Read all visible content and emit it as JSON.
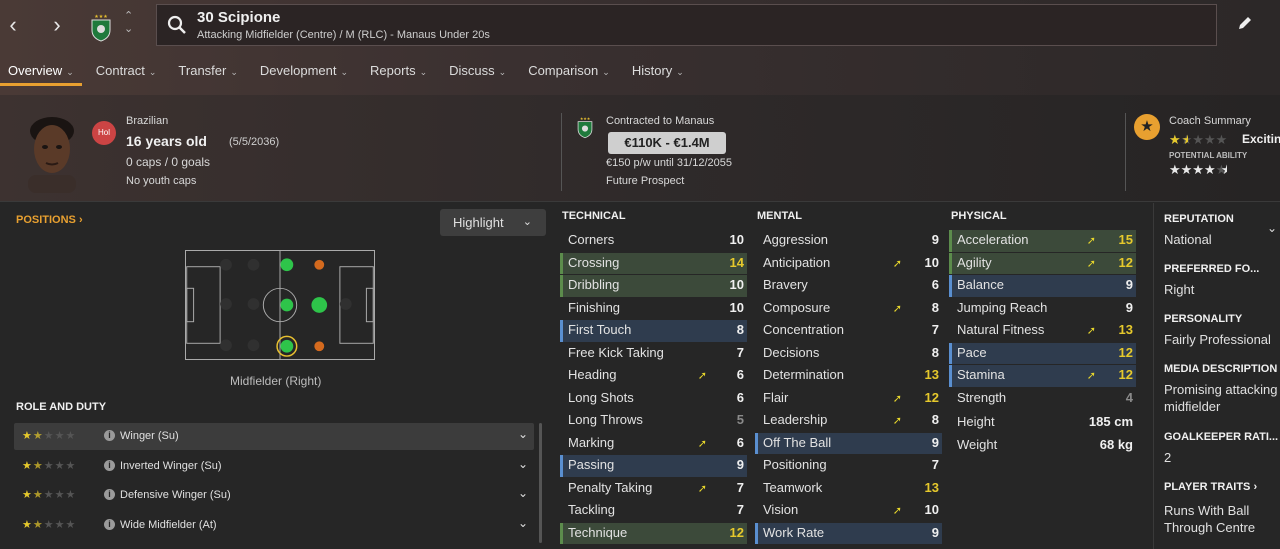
{
  "header": {
    "player_title": "30 Scipione",
    "player_subtitle": "Attacking Midfielder (Centre) / M (RLC) - Manaus Under 20s",
    "tabs": [
      {
        "label": "Overview",
        "active": true
      },
      {
        "label": "Contract"
      },
      {
        "label": "Transfer"
      },
      {
        "label": "Development"
      },
      {
        "label": "Reports"
      },
      {
        "label": "Discuss"
      },
      {
        "label": "Comparison"
      },
      {
        "label": "History"
      }
    ]
  },
  "profile": {
    "nationality": "Brazilian",
    "hol_badge": "Hol",
    "age": "16 years old",
    "dob": "(5/5/2036)",
    "caps": "0 caps / 0 goals",
    "youth_caps": "No youth caps"
  },
  "contract": {
    "contracted_to": "Contracted to Manaus",
    "value_range": "€110K - €1.4M",
    "wage": "€150 p/w until 31/12/2055",
    "status": "Future Prospect"
  },
  "coach": {
    "title": "Coach Summary",
    "current_stars": 1.5,
    "label": "Excitin",
    "potential_label": "POTENTIAL ABILITY",
    "potential_stars": 4.5
  },
  "positions": {
    "title": "POSITIONS",
    "highlight_label": "Highlight",
    "position_label": "Midfielder (Right)"
  },
  "role_duty": {
    "title": "ROLE AND DUTY",
    "roles": [
      {
        "name": "Winger (Su)",
        "stars": 1.5,
        "selected": true
      },
      {
        "name": "Inverted Winger (Su)",
        "stars": 1.5
      },
      {
        "name": "Defensive Winger (Su)",
        "stars": 1.5
      },
      {
        "name": "Wide Midfielder (At)",
        "stars": 1.5
      }
    ]
  },
  "technical": {
    "title": "TECHNICAL",
    "attrs": [
      {
        "name": "Corners",
        "value": "10"
      },
      {
        "name": "Crossing",
        "value": "14",
        "hl": "g",
        "hi": true
      },
      {
        "name": "Dribbling",
        "value": "10",
        "hl": "g"
      },
      {
        "name": "Finishing",
        "value": "10"
      },
      {
        "name": "First Touch",
        "value": "8",
        "hl": "b"
      },
      {
        "name": "Free Kick Taking",
        "value": "7"
      },
      {
        "name": "Heading",
        "value": "6",
        "arrow": true
      },
      {
        "name": "Long Shots",
        "value": "6"
      },
      {
        "name": "Long Throws",
        "value": "5",
        "lo": true
      },
      {
        "name": "Marking",
        "value": "6",
        "arrow": true
      },
      {
        "name": "Passing",
        "value": "9",
        "hl": "b"
      },
      {
        "name": "Penalty Taking",
        "value": "7",
        "arrow": true
      },
      {
        "name": "Tackling",
        "value": "7"
      },
      {
        "name": "Technique",
        "value": "12",
        "hl": "g",
        "hi": true
      }
    ]
  },
  "mental": {
    "title": "MENTAL",
    "attrs": [
      {
        "name": "Aggression",
        "value": "9"
      },
      {
        "name": "Anticipation",
        "value": "10",
        "arrow": true
      },
      {
        "name": "Bravery",
        "value": "6"
      },
      {
        "name": "Composure",
        "value": "8",
        "arrow": true
      },
      {
        "name": "Concentration",
        "value": "7"
      },
      {
        "name": "Decisions",
        "value": "8"
      },
      {
        "name": "Determination",
        "value": "13",
        "hi": true
      },
      {
        "name": "Flair",
        "value": "12",
        "arrow": true,
        "hi": true
      },
      {
        "name": "Leadership",
        "value": "8",
        "arrow": true
      },
      {
        "name": "Off The Ball",
        "value": "9",
        "hl": "b"
      },
      {
        "name": "Positioning",
        "value": "7"
      },
      {
        "name": "Teamwork",
        "value": "13",
        "hi": true
      },
      {
        "name": "Vision",
        "value": "10",
        "arrow": true
      },
      {
        "name": "Work Rate",
        "value": "9",
        "hl": "b"
      }
    ]
  },
  "physical": {
    "title": "PHYSICAL",
    "attrs": [
      {
        "name": "Acceleration",
        "value": "15",
        "hl": "g",
        "arrow": true,
        "hi": true
      },
      {
        "name": "Agility",
        "value": "12",
        "hl": "g",
        "arrow": true,
        "hi": true
      },
      {
        "name": "Balance",
        "value": "9",
        "hl": "b"
      },
      {
        "name": "Jumping Reach",
        "value": "9"
      },
      {
        "name": "Natural Fitness",
        "value": "13",
        "arrow": true,
        "hi": true
      },
      {
        "name": "Pace",
        "value": "12",
        "hl": "b",
        "hi": true
      },
      {
        "name": "Stamina",
        "value": "12",
        "hl": "b",
        "arrow": true,
        "hi": true
      },
      {
        "name": "Strength",
        "value": "4",
        "lo": true
      }
    ],
    "height_label": "Height",
    "height_value": "185 cm",
    "weight_label": "Weight",
    "weight_value": "68 kg"
  },
  "sidebar": {
    "reputation_title": "REPUTATION",
    "reputation_value": "National",
    "preferred_title": "PREFERRED FO...",
    "preferred_value": "Right",
    "personality_title": "PERSONALITY",
    "personality_value": "Fairly Professional",
    "media_title": "MEDIA DESCRIPTION",
    "media_value": "Promising attacking midfielder",
    "gk_title": "GOALKEEPER RATI...",
    "gk_value": "2",
    "traits_title": "PLAYER TRAITS",
    "traits_value": "Runs With Ball Through Centre"
  },
  "colors": {
    "accent": "#e8a030",
    "highlight_green": "#3c4a3a",
    "highlight_blue": "#2f3c4e",
    "high_value": "#e6c92c"
  }
}
